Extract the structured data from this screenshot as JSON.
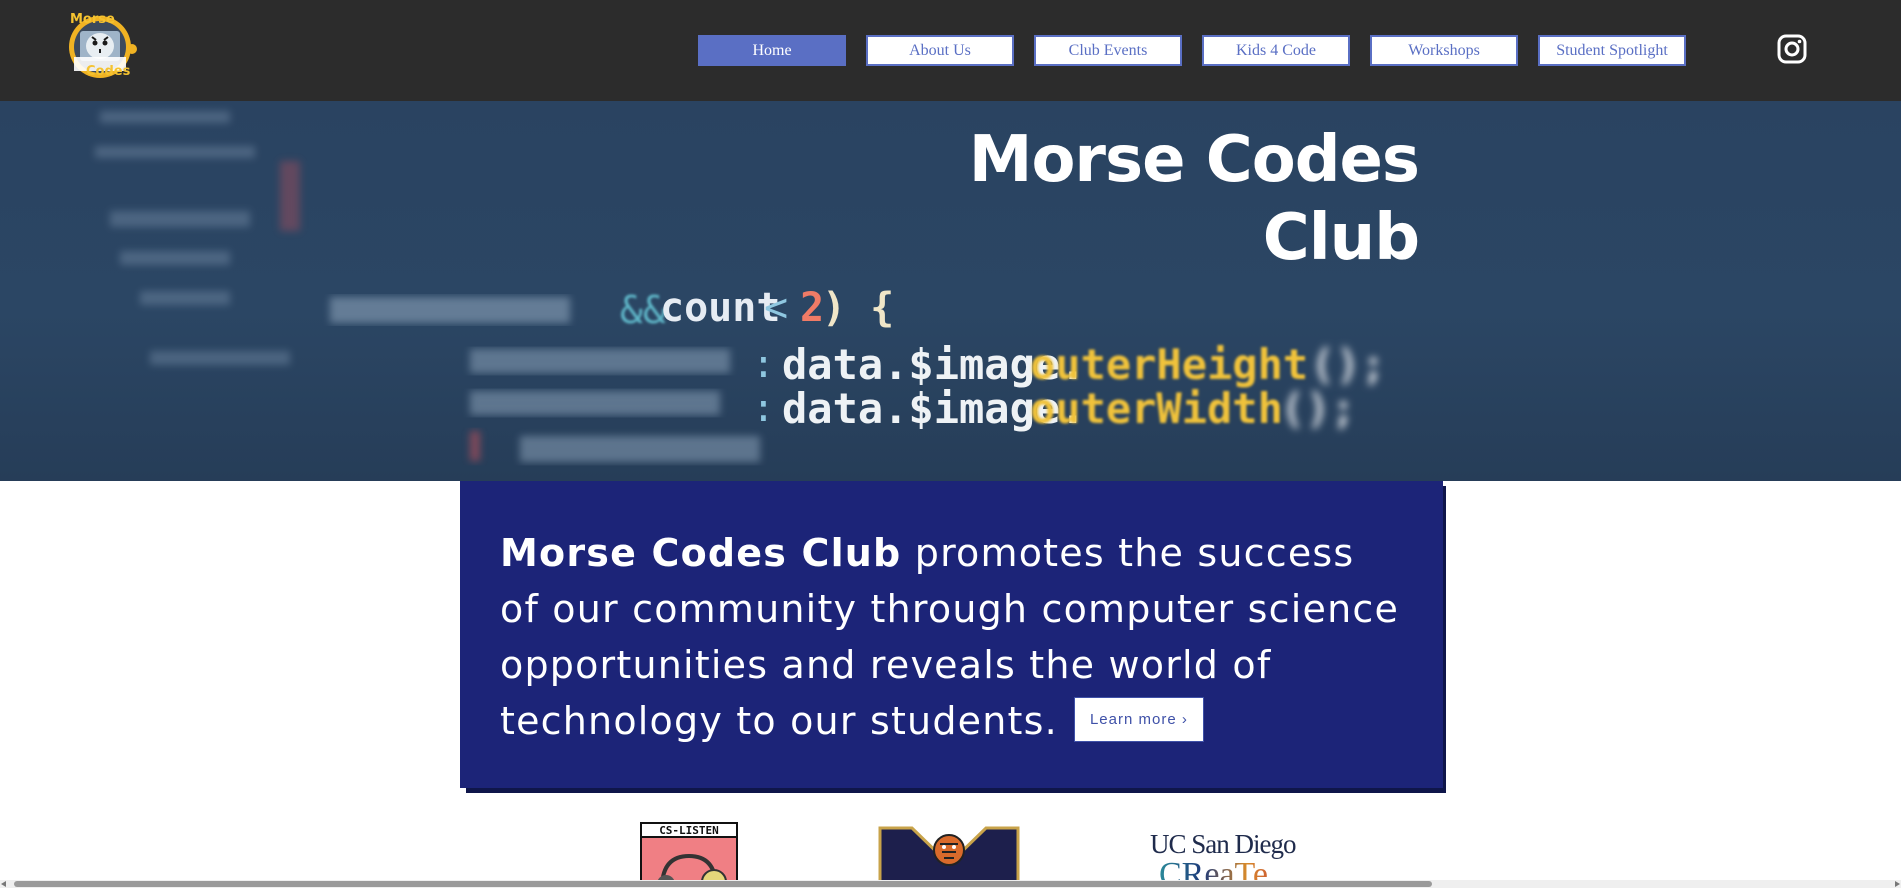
{
  "header": {
    "logo_text_top": "Morse",
    "logo_text_bottom": "Codes",
    "nav": [
      {
        "label": "Home",
        "active": true
      },
      {
        "label": "About Us",
        "active": false
      },
      {
        "label": "Club Events",
        "active": false
      },
      {
        "label": "Kids 4 Code",
        "active": false
      },
      {
        "label": "Workshops",
        "active": false
      },
      {
        "label": "Student Spotlight",
        "active": false
      }
    ],
    "social_icon": "instagram-icon"
  },
  "hero": {
    "title_line1": "Morse Codes",
    "title_line2": "Club",
    "code_lines": [
      "this.viewerHeight && count < 2) {",
      "data.$image.outerHeight();",
      "data.$image.outerWidth();",
      "this.imageHeight;"
    ]
  },
  "mission": {
    "bold": "Morse Codes Club",
    "text": " promotes the success of our community through computer science opportunities and reveals the world of technology to our students.",
    "button_label": "Learn more ›"
  },
  "partners": {
    "cs_listen": "CS-LISTEN",
    "ucsd_line1": "UC San Diego",
    "ucsd_line2": "CReaTe"
  },
  "colors": {
    "header_bg": "#2c2c2c",
    "nav_accent": "#5a6fc4",
    "mission_bg": "#1c2478",
    "hero_bg": "#2b4664"
  }
}
